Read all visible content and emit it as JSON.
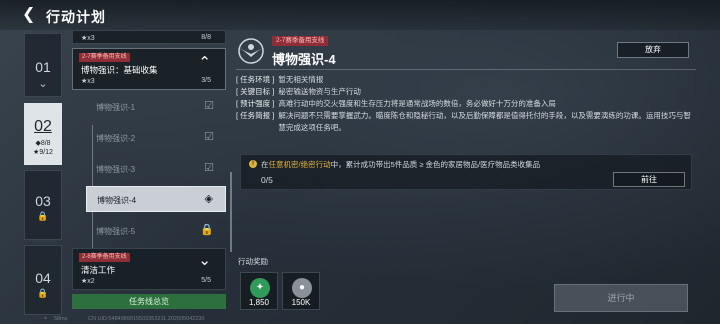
{
  "header": {
    "title": "行动计划"
  },
  "chapters": [
    {
      "number": "01"
    },
    {
      "number": "02",
      "stat_a": "◆8/8",
      "stat_b": "★9/12"
    },
    {
      "number": "03"
    },
    {
      "number": "04"
    }
  ],
  "quest_list": {
    "top_card": {
      "stars": "★x3",
      "progress": "8/8"
    },
    "expanded_card": {
      "tag": "2-7赛季备用支线",
      "name": "博物强识：基础收集",
      "stars": "★x3",
      "progress": "3/5"
    },
    "sub_items": [
      {
        "label": "博物强识-1",
        "state": "done"
      },
      {
        "label": "博物强识-2",
        "state": "done"
      },
      {
        "label": "博物强识-3",
        "state": "done"
      },
      {
        "label": "博物强识-4",
        "state": "active"
      },
      {
        "label": "博物强识-5",
        "state": "locked"
      }
    ],
    "bottom_card": {
      "tag": "2-8赛季备用支线",
      "name": "清洁工作",
      "stars": "★x2",
      "progress": "5/5"
    },
    "summary_button": "任务线总览"
  },
  "detail": {
    "tag": "2-7赛季备用支线",
    "title": "博物强识-4",
    "abandon_button": "放弃",
    "info": [
      {
        "key": "[ 任务环境 ]",
        "value": "暂无相关情报"
      },
      {
        "key": "[ 关键目标 ]",
        "value": "秘密输送物资与生产行动"
      },
      {
        "key": "[ 预计强度 ]",
        "value": "高难行动中的交火强度和生存压力将是通常战场的数倍，务必做好十万分的准备入局"
      },
      {
        "key": "[ 任务简报 ]",
        "value": "解决问题不只需要掌握武力。瞄度陈仓和隐秘行动，以及后勤保障都是值得托付的手段，以及需要演练的功课。运用技巧与智慧完成这项任务吧。"
      }
    ],
    "objective": {
      "prefix": "在",
      "highlight": "任意机密/绝密行动",
      "suffix": "中，累计成功带出5件品质 ≥ 金色的家居物品/医疗物品类收集品",
      "count": "0/5",
      "goto_button": "前往"
    },
    "rewards_label": "行动奖励",
    "rewards": [
      {
        "icon": "medal-icon",
        "count": "1,850",
        "color": "#2f9a5a"
      },
      {
        "icon": "coin-icon",
        "count": "150K",
        "color": "#8a9198"
      }
    ],
    "progress_button": "进行中"
  },
  "footer": {
    "ping": "58ms",
    "uid": "CN UID:5484989915503353211.202605042230"
  }
}
